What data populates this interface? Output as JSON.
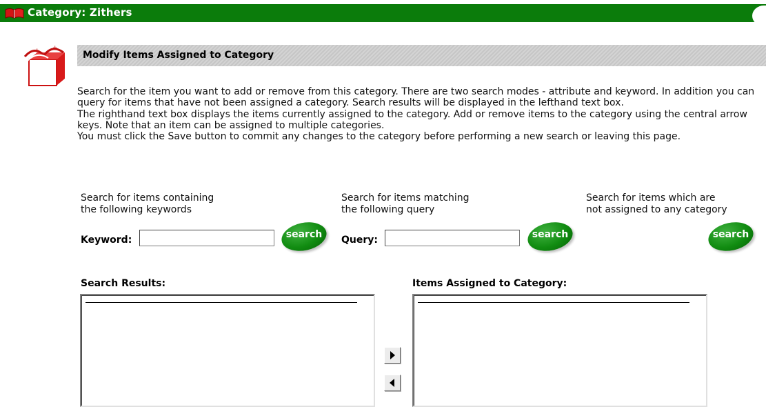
{
  "window": {
    "title": "Category: Zithers"
  },
  "section": {
    "title": "Modify Items Assigned to Category"
  },
  "instructions": [
    "Search for the item you want to add or remove from this category. There are two search modes - attribute and keyword. In addition you can query for items that have not been assigned a category. Search results will be displayed in the lefthand text box.",
    "The righthand text box displays the items currently assigned to the category. Add or remove items to the category using the central arrow keys. Note that an item can be assigned to multiple categories.",
    "You must click the Save button to commit any changes to the category before performing a new search or leaving this page."
  ],
  "search": {
    "keyword": {
      "description_line1": "Search for items containing",
      "description_line2": "the following keywords",
      "label": "Keyword:",
      "value": "",
      "button": "search"
    },
    "query": {
      "description_line1": "Search for items matching",
      "description_line2": "the following query",
      "label": "Query:",
      "value": "",
      "button": "search"
    },
    "unassigned": {
      "description_line1": "Search for items which are",
      "description_line2": "not assigned to any category",
      "button": "search"
    }
  },
  "lists": {
    "results_label": "Search Results:",
    "assigned_label": "Items Assigned to Category:"
  },
  "icons": {
    "title": "book-icon",
    "section": "category-box-icon",
    "add": "arrow-right-icon",
    "remove": "arrow-left-icon"
  },
  "colors": {
    "titlebar": "#0b7c0b",
    "button": "#118c11",
    "header_band": "#cccccc"
  }
}
